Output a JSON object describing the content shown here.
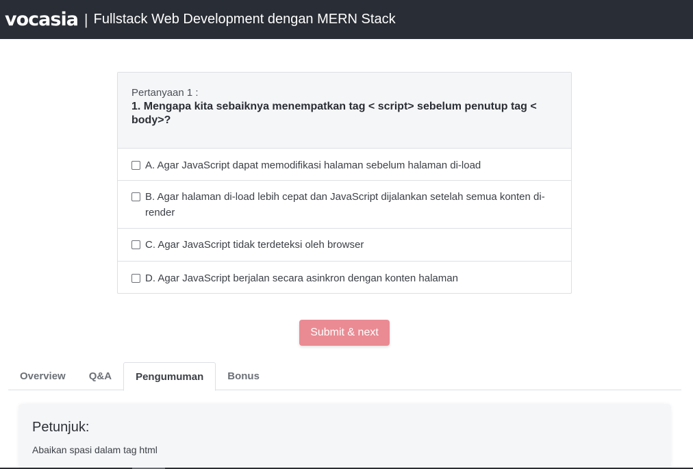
{
  "header": {
    "logo_text": "vocasia",
    "separator": "|",
    "course_title": "Fullstack Web Development dengan MERN Stack"
  },
  "quiz": {
    "question_label": "Pertanyaan 1 :",
    "question_text": "1. Mengapa kita sebaiknya menempatkan tag < script> sebelum penutup tag < body>?",
    "options": [
      {
        "label": "A. Agar JavaScript dapat memodifikasi halaman sebelum halaman di-load",
        "checked": false
      },
      {
        "label": "B. Agar halaman di-load lebih cepat dan JavaScript dijalankan setelah semua konten di-render",
        "checked": false
      },
      {
        "label": "C. Agar JavaScript tidak terdeteksi oleh browser",
        "checked": false
      },
      {
        "label": "D. Agar JavaScript berjalan secara asinkron dengan konten halaman",
        "checked": false
      }
    ],
    "submit_label": "Submit & next"
  },
  "tabs": [
    {
      "label": "Overview",
      "active": false
    },
    {
      "label": "Q&A",
      "active": false
    },
    {
      "label": "Pengumuman",
      "active": true
    },
    {
      "label": "Bonus",
      "active": false
    }
  ],
  "hint": {
    "title": "Petunjuk:",
    "text": "Abaikan spasi dalam tag html"
  },
  "colors": {
    "header_bg": "#292d35",
    "submit_bg": "#ea8b93",
    "card_header_bg": "#f5f6f8"
  }
}
